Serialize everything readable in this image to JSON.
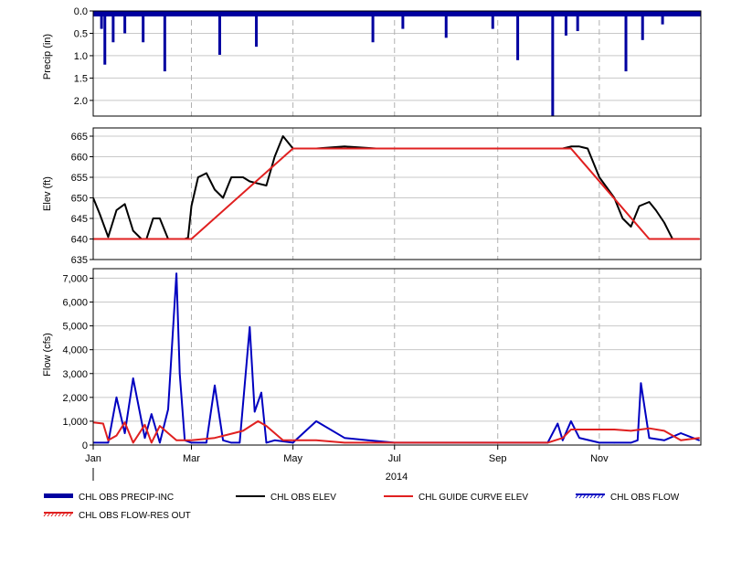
{
  "chart_data": [
    {
      "type": "bar",
      "ylabel": "Precip (in)",
      "ylim": [
        0,
        2.35
      ],
      "y_inverted": true,
      "yticks": [
        "0.0",
        "0.5",
        "1.0",
        "1.5",
        "2.0"
      ],
      "grid": true,
      "series": [
        {
          "name": "CHL OBS PRECIP-INC",
          "color": "#0000a0",
          "x": [
            "2014-01-06",
            "2014-01-08",
            "2014-01-13",
            "2014-01-20",
            "2014-01-31",
            "2014-02-13",
            "2014-03-18",
            "2014-04-09",
            "2014-06-18",
            "2014-07-06",
            "2014-08-01",
            "2014-08-29",
            "2014-09-13",
            "2014-10-04",
            "2014-10-12",
            "2014-10-19",
            "2014-11-17",
            "2014-11-27",
            "2014-12-09"
          ],
          "values": [
            0.4,
            1.2,
            0.7,
            0.5,
            0.7,
            1.35,
            0.98,
            0.8,
            0.7,
            0.4,
            0.6,
            0.4,
            1.1,
            2.4,
            0.55,
            0.45,
            1.35,
            0.65,
            0.3
          ]
        }
      ]
    },
    {
      "type": "line",
      "ylabel": "Elev (ft)",
      "ylim": [
        635,
        667
      ],
      "yticks": [
        "635",
        "640",
        "645",
        "650",
        "655",
        "660",
        "665"
      ],
      "grid": true,
      "series": [
        {
          "name": "CHL OBS ELEV",
          "color": "#000000",
          "x": [
            "2014-01-01",
            "2014-01-05",
            "2014-01-10",
            "2014-01-15",
            "2014-01-20",
            "2014-01-25",
            "2014-01-30",
            "2014-02-02",
            "2014-02-06",
            "2014-02-10",
            "2014-02-15",
            "2014-02-20",
            "2014-02-25",
            "2014-02-27",
            "2014-03-01",
            "2014-03-05",
            "2014-03-10",
            "2014-03-15",
            "2014-03-20",
            "2014-03-25",
            "2014-04-01",
            "2014-04-05",
            "2014-04-10",
            "2014-04-15",
            "2014-04-20",
            "2014-04-25",
            "2014-05-01",
            "2014-05-15",
            "2014-06-01",
            "2014-06-20",
            "2014-07-10",
            "2014-08-01",
            "2014-08-20",
            "2014-09-10",
            "2014-09-30",
            "2014-10-10",
            "2014-10-15",
            "2014-10-20",
            "2014-10-25",
            "2014-11-01",
            "2014-11-10",
            "2014-11-15",
            "2014-11-20",
            "2014-11-25",
            "2014-12-01",
            "2014-12-05",
            "2014-12-10",
            "2014-12-15",
            "2014-12-20",
            "2014-12-25",
            "2014-12-31"
          ],
          "values": [
            650,
            646,
            640.5,
            647,
            648.5,
            642,
            640,
            640,
            645,
            645,
            640,
            640,
            640,
            640.3,
            648,
            655,
            656,
            652,
            650,
            655,
            655,
            654,
            653.5,
            653,
            660,
            665,
            662,
            662,
            662.5,
            662,
            662,
            662,
            662,
            662,
            662,
            662,
            662.5,
            662.5,
            662,
            655,
            650,
            645,
            643,
            648,
            649,
            647,
            644,
            640,
            640,
            640,
            640
          ]
        },
        {
          "name": "CHL GUIDE CURVE ELEV",
          "color": "#e02020",
          "x": [
            "2014-01-01",
            "2014-03-01",
            "2014-05-01",
            "2014-10-15",
            "2014-12-01",
            "2014-12-31"
          ],
          "values": [
            640,
            640,
            662,
            662,
            640,
            640
          ]
        }
      ]
    },
    {
      "type": "line",
      "ylabel": "Flow (cfs)",
      "ylim": [
        0,
        7400
      ],
      "yticks": [
        "0",
        "1,000",
        "2,000",
        "3,000",
        "4,000",
        "5,000",
        "6,000",
        "7,000"
      ],
      "grid": true,
      "series": [
        {
          "name": "CHL OBS FLOW",
          "color": "#0000c0",
          "x": [
            "2014-01-01",
            "2014-01-10",
            "2014-01-15",
            "2014-01-20",
            "2014-01-25",
            "2014-02-01",
            "2014-02-05",
            "2014-02-10",
            "2014-02-15",
            "2014-02-20",
            "2014-02-22",
            "2014-02-25",
            "2014-03-01",
            "2014-03-05",
            "2014-03-10",
            "2014-03-15",
            "2014-03-20",
            "2014-03-25",
            "2014-03-30",
            "2014-04-05",
            "2014-04-08",
            "2014-04-12",
            "2014-04-15",
            "2014-04-20",
            "2014-05-01",
            "2014-05-15",
            "2014-06-01",
            "2014-06-15",
            "2014-07-01",
            "2014-07-15",
            "2014-08-01",
            "2014-08-15",
            "2014-09-01",
            "2014-09-15",
            "2014-10-01",
            "2014-10-07",
            "2014-10-10",
            "2014-10-15",
            "2014-10-20",
            "2014-11-01",
            "2014-11-10",
            "2014-11-20",
            "2014-11-24",
            "2014-11-26",
            "2014-12-01",
            "2014-12-10",
            "2014-12-20",
            "2014-12-31"
          ],
          "values": [
            100,
            100,
            2000,
            500,
            2800,
            300,
            1300,
            100,
            1500,
            7200,
            3000,
            200,
            100,
            100,
            100,
            2500,
            200,
            100,
            100,
            4950,
            1400,
            2200,
            100,
            200,
            100,
            1000,
            300,
            200,
            100,
            100,
            100,
            100,
            100,
            100,
            100,
            900,
            200,
            1000,
            300,
            100,
            100,
            100,
            200,
            2600,
            300,
            200,
            500,
            200
          ]
        },
        {
          "name": "CHL OBS FLOW-RES OUT",
          "color": "#e02020",
          "x": [
            "2014-01-01",
            "2014-01-07",
            "2014-01-10",
            "2014-01-15",
            "2014-01-20",
            "2014-01-25",
            "2014-02-01",
            "2014-02-05",
            "2014-02-10",
            "2014-02-15",
            "2014-02-20",
            "2014-03-01",
            "2014-03-15",
            "2014-04-01",
            "2014-04-10",
            "2014-04-15",
            "2014-04-25",
            "2014-05-15",
            "2014-06-01",
            "2014-06-15",
            "2014-07-01",
            "2014-08-01",
            "2014-09-01",
            "2014-10-01",
            "2014-10-10",
            "2014-10-15",
            "2014-10-20",
            "2014-11-01",
            "2014-11-10",
            "2014-11-20",
            "2014-12-01",
            "2014-12-10",
            "2014-12-20",
            "2014-12-31"
          ],
          "values": [
            950,
            900,
            200,
            400,
            950,
            100,
            850,
            100,
            800,
            500,
            200,
            200,
            300,
            600,
            1000,
            800,
            200,
            200,
            100,
            100,
            100,
            100,
            100,
            100,
            300,
            650,
            650,
            650,
            650,
            600,
            700,
            600,
            200,
            300
          ]
        }
      ],
      "xlim": [
        "2014-01-01",
        "2014-12-31"
      ],
      "xticks": [
        "Jan",
        "Mar",
        "May",
        "Jul",
        "Sep",
        "Nov"
      ],
      "xlabel": "2014"
    }
  ],
  "legend": [
    {
      "label": "CHL OBS PRECIP-INC",
      "color": "#0000a0",
      "style": "thick"
    },
    {
      "label": "CHL OBS ELEV",
      "color": "#000000",
      "style": "line"
    },
    {
      "label": "CHL GUIDE CURVE ELEV",
      "color": "#e02020",
      "style": "line"
    },
    {
      "label": "CHL OBS FLOW",
      "color": "#0000c0",
      "style": "hatch"
    },
    {
      "label": "CHL OBS FLOW-RES OUT",
      "color": "#e02020",
      "style": "hatch"
    }
  ]
}
